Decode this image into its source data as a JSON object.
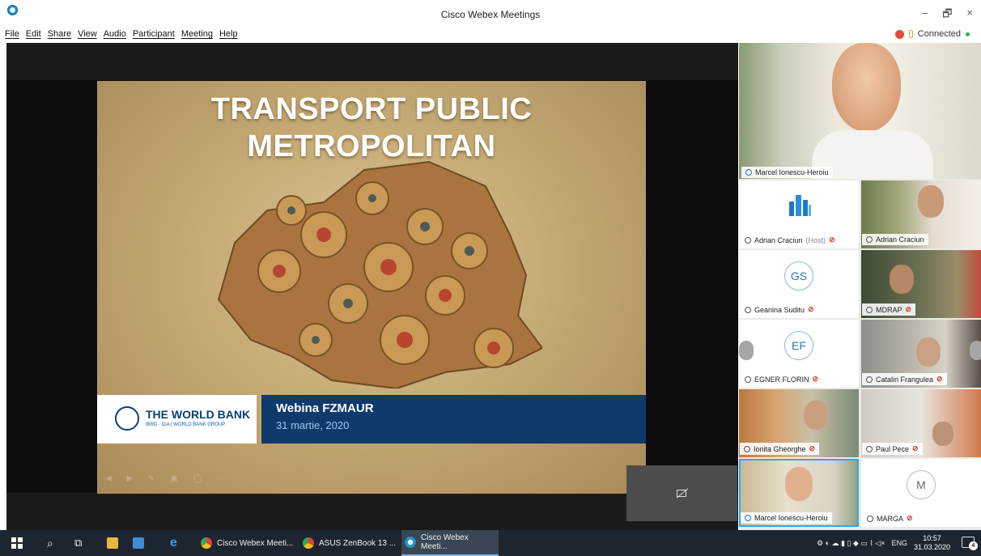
{
  "window": {
    "title": "Cisco Webex Meetings",
    "minimize": "–",
    "restore": "🗗",
    "close": "×"
  },
  "menu": [
    "File",
    "Edit",
    "Share",
    "View",
    "Audio",
    "Participant",
    "Meeting",
    "Help"
  ],
  "status": {
    "connection": "Connected"
  },
  "slide": {
    "title_line1": "TRANSPORT PUBLIC",
    "title_line2": "METROPOLITAN",
    "org_name": "THE WORLD BANK",
    "org_sub": "IBRD · IDA | WORLD BANK GROUP",
    "event_title": "Webina FZMAUR",
    "event_date": "31 martie, 2020"
  },
  "active_speaker": {
    "name": "Marcel Ionescu-Heroiu"
  },
  "participants": [
    {
      "name": "Adrian Craciun",
      "tag": "(Host)",
      "avatar": "",
      "muted": true
    },
    {
      "name": "Adrian Craciun",
      "tag": "",
      "avatar": "",
      "muted": false
    },
    {
      "name": "Geanina Suditu",
      "tag": "",
      "avatar": "GS",
      "muted": true
    },
    {
      "name": "MDRAP",
      "tag": "",
      "avatar": "",
      "muted": true
    },
    {
      "name": "EGNER FLORIN",
      "tag": "",
      "avatar": "EF",
      "muted": true
    },
    {
      "name": "Catalin Frangulea",
      "tag": "",
      "avatar": "",
      "muted": true
    },
    {
      "name": "Ionita Gheorghe",
      "tag": "",
      "avatar": "",
      "muted": true
    },
    {
      "name": "Paul Pece",
      "tag": "",
      "avatar": "",
      "muted": true
    },
    {
      "name": "Marcel Ionescu-Heroiu",
      "tag": "",
      "avatar": "",
      "muted": false
    },
    {
      "name": "MARGA",
      "tag": "",
      "avatar": "M",
      "muted": true
    }
  ],
  "taskbar": {
    "items": [
      "Cisco Webex Meeti...",
      "ASUS ZenBook 13 ...",
      "Cisco Webex Meeti..."
    ],
    "language": "ENG",
    "time": "10:57",
    "date": "31.03.2020",
    "notifications": "4"
  },
  "colors": {
    "slide_navy": "#0f3a6b",
    "webex_blue": "#1f7ac4",
    "mute_red": "#d23b2e",
    "taskbar": "#1d2630"
  }
}
